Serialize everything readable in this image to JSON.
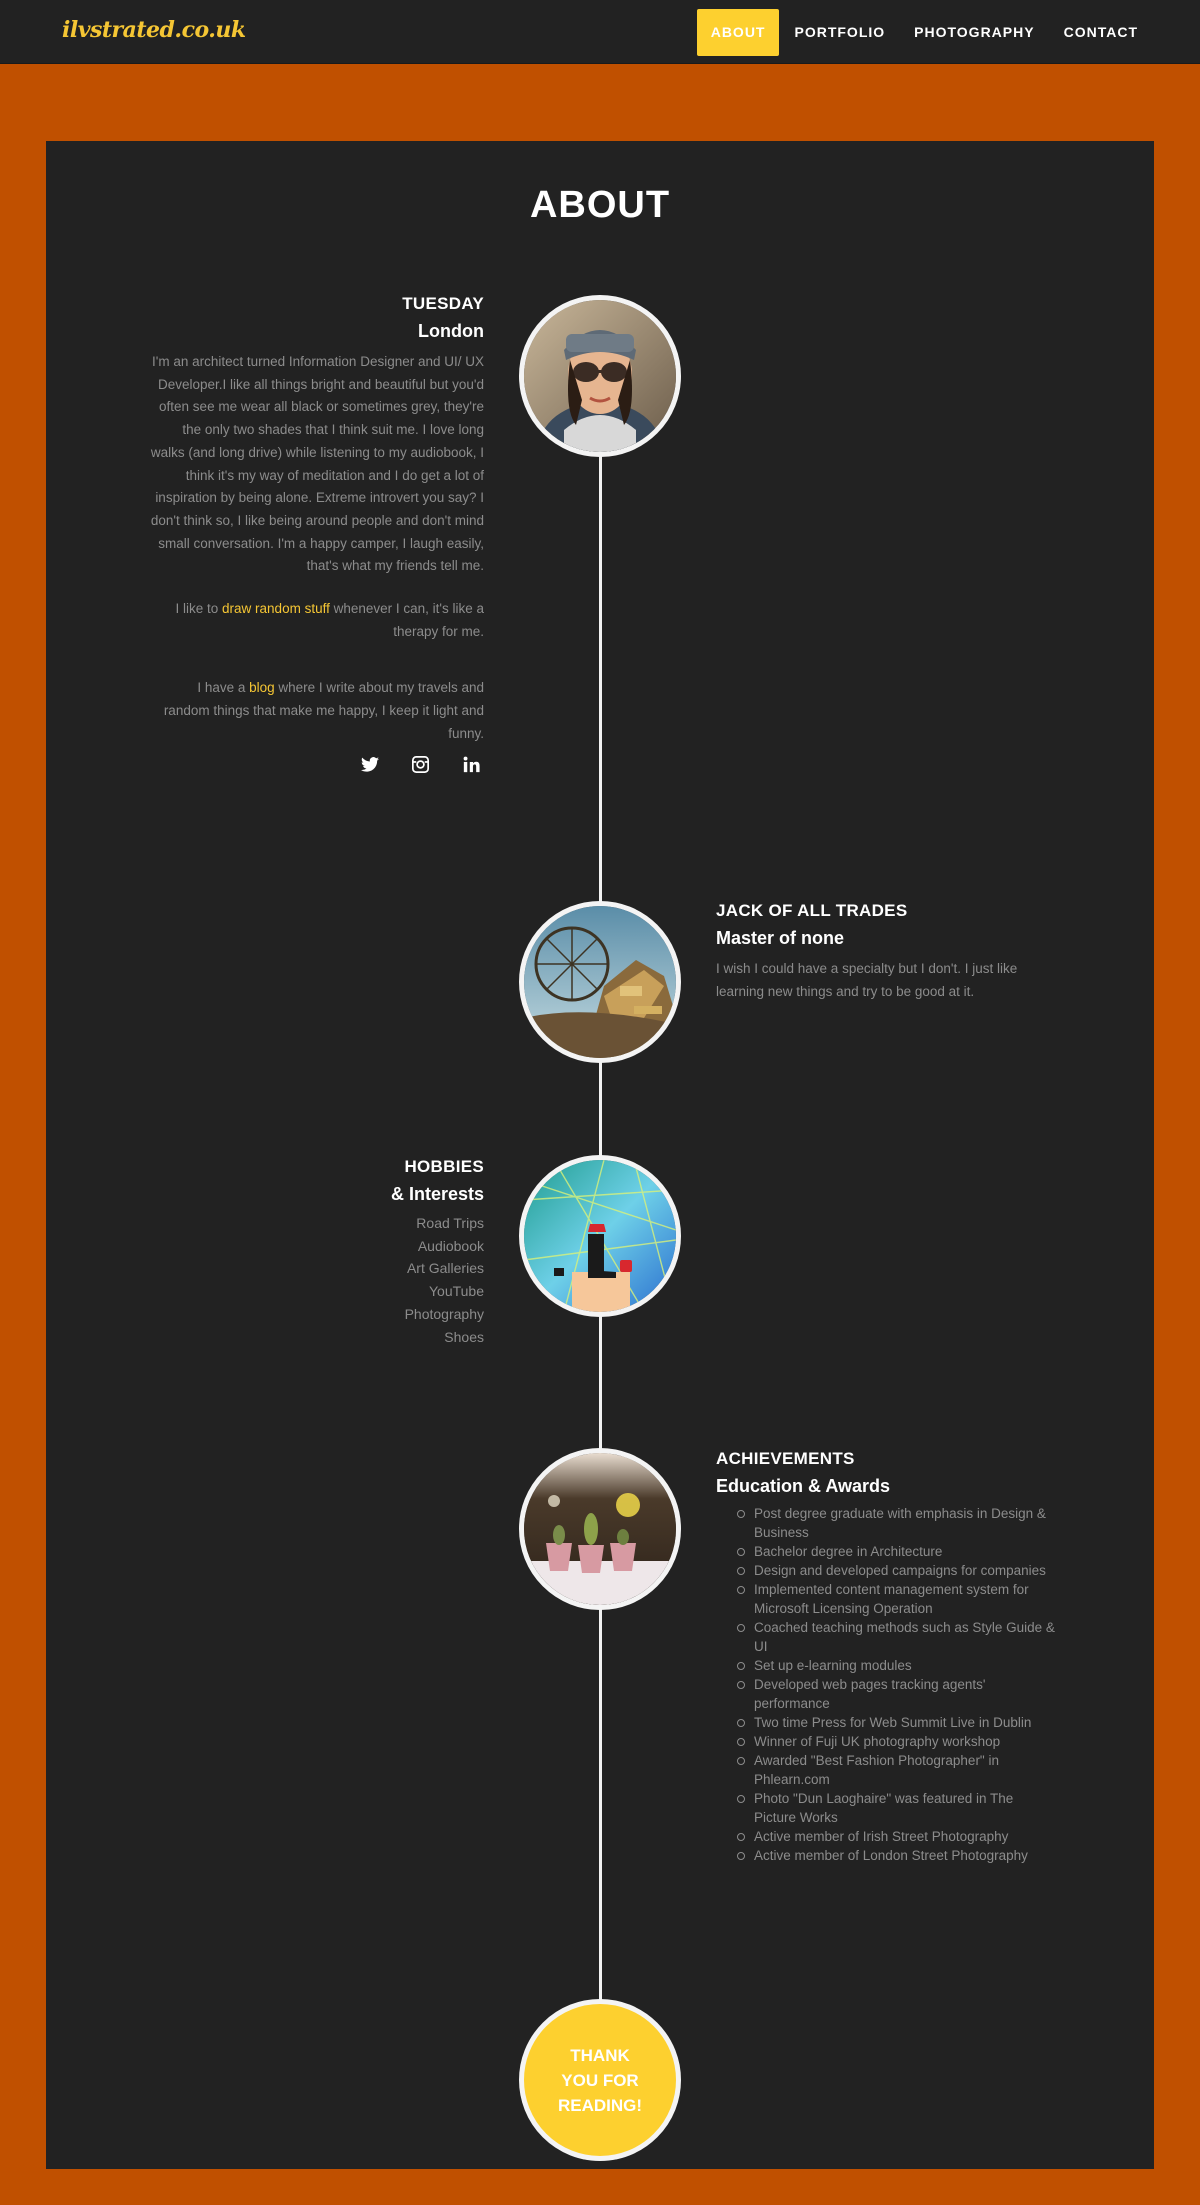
{
  "nav": {
    "logo": "ilvstrated.co.uk",
    "items": [
      {
        "label": "ABOUT",
        "active": true
      },
      {
        "label": "PORTFOLIO",
        "active": false
      },
      {
        "label": "PHOTOGRAPHY",
        "active": false
      },
      {
        "label": "CONTACT",
        "active": false
      }
    ]
  },
  "page": {
    "title": "ABOUT"
  },
  "sections": {
    "intro": {
      "heading1": "TUESDAY",
      "heading2": "London",
      "bio": "I'm an architect turned Information Designer and UI/ UX Developer.I like all things bright and beautiful but you'd often see me wear all black or sometimes grey, they're the only two shades that I think suit me. I love long walks (and long drive) while listening to my audiobook, I think it's my way of meditation and I do get a lot of inspiration by being alone. Extreme introvert you say? I don't think so, I like being around people and don't mind small conversation. I'm a happy camper, I laugh easily, that's what my friends tell me.",
      "draw_before": "I like to ",
      "draw_link": "draw random stuff",
      "draw_after": " whenever I can, it's like a therapy for me.",
      "blog_before": "I have a ",
      "blog_link": "blog",
      "blog_after": " where I write about my travels and random things that make me happy, I keep it light and funny.",
      "social": [
        "twitter-icon",
        "instagram-icon",
        "linkedin-icon"
      ]
    },
    "trades": {
      "heading1": "JACK OF ALL TRADES",
      "heading2": "Master of none",
      "text": "I wish I could have a specialty but I don't. I just like learning new things and try to be good at it."
    },
    "hobbies": {
      "heading1": "HOBBIES",
      "heading2": "& Interests",
      "items": [
        "Road Trips",
        "Audiobook",
        "Art Galleries",
        "YouTube",
        "Photography",
        "Shoes"
      ]
    },
    "achievements": {
      "heading1": "ACHIEVEMENTS",
      "heading2": "Education & Awards",
      "items": [
        "Post degree graduate with emphasis in Design & Business",
        "Bachelor degree in Architecture",
        "Design and developed campaigns for companies",
        "Implemented content management system for Microsoft Licensing Operation",
        "Coached teaching methods such as Style Guide & UI",
        "Set up e-learning modules",
        "Developed web pages tracking agents' performance",
        "Two time Press for Web Summit Live in Dublin",
        "Winner of Fuji UK photography workshop",
        "Awarded \"Best Fashion Photographer\" in Phlearn.com",
        "Photo \"Dun Laoghaire\" was featured in The Picture Works",
        "Active member of Irish Street Photography",
        "Active member of London Street Photography"
      ]
    },
    "thanks": {
      "line1": "THANK",
      "line2": "YOU FOR",
      "line3": "READING!"
    }
  },
  "colors": {
    "accent": "#fdd02f",
    "background": "#c05000",
    "panel": "#222222"
  }
}
